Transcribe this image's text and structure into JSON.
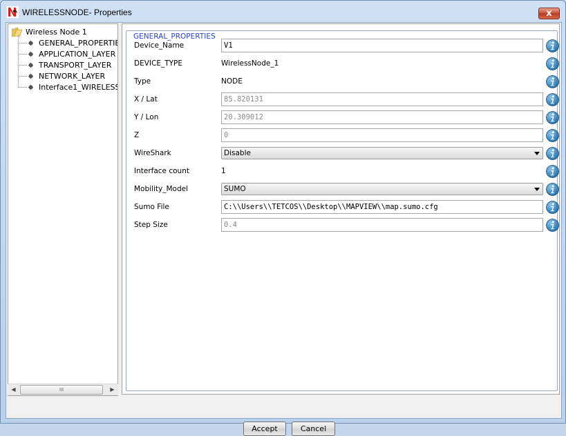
{
  "window": {
    "title": "WIRELESSNODE- Properties",
    "close_label": "x",
    "app_icon": "netsim-logo-icon"
  },
  "tree": {
    "root_label": "Wireless Node 1",
    "items": [
      {
        "label": "GENERAL_PROPERTIES"
      },
      {
        "label": "APPLICATION_LAYER"
      },
      {
        "label": "TRANSPORT_LAYER"
      },
      {
        "label": "NETWORK_LAYER"
      },
      {
        "label": "Interface1_WIRELESS"
      }
    ],
    "scrollbar_thumb_grip": "III"
  },
  "properties": {
    "group_title": "GENERAL_PROPERTIES",
    "rows": [
      {
        "label": "Device_Name",
        "kind": "input",
        "value": "V1",
        "enabled": true
      },
      {
        "label": "DEVICE_TYPE",
        "kind": "text",
        "value": "WirelessNode_1"
      },
      {
        "label": "Type",
        "kind": "text",
        "value": "NODE"
      },
      {
        "label": "X / Lat",
        "kind": "input",
        "value": "85.820131",
        "enabled": false
      },
      {
        "label": "Y / Lon",
        "kind": "input",
        "value": "20.309012",
        "enabled": false
      },
      {
        "label": "Z",
        "kind": "input",
        "value": "0",
        "enabled": false
      },
      {
        "label": "WireShark",
        "kind": "select",
        "value": "Disable"
      },
      {
        "label": "Interface count",
        "kind": "text",
        "value": "1"
      },
      {
        "label": "Mobility_Model",
        "kind": "select",
        "value": "SUMO"
      },
      {
        "label": "Sumo File",
        "kind": "input",
        "value": "C:\\\\Users\\\\TETCOS\\\\Desktop\\\\MAPVIEW\\\\map.sumo.cfg",
        "enabled": true
      },
      {
        "label": "Step Size",
        "kind": "input",
        "value": "0.4",
        "enabled": false
      }
    ]
  },
  "buttons": {
    "accept": "Accept",
    "cancel": "Cancel"
  },
  "colors": {
    "legend": "#2a48c8",
    "info_icon": "#1f6ea8"
  }
}
